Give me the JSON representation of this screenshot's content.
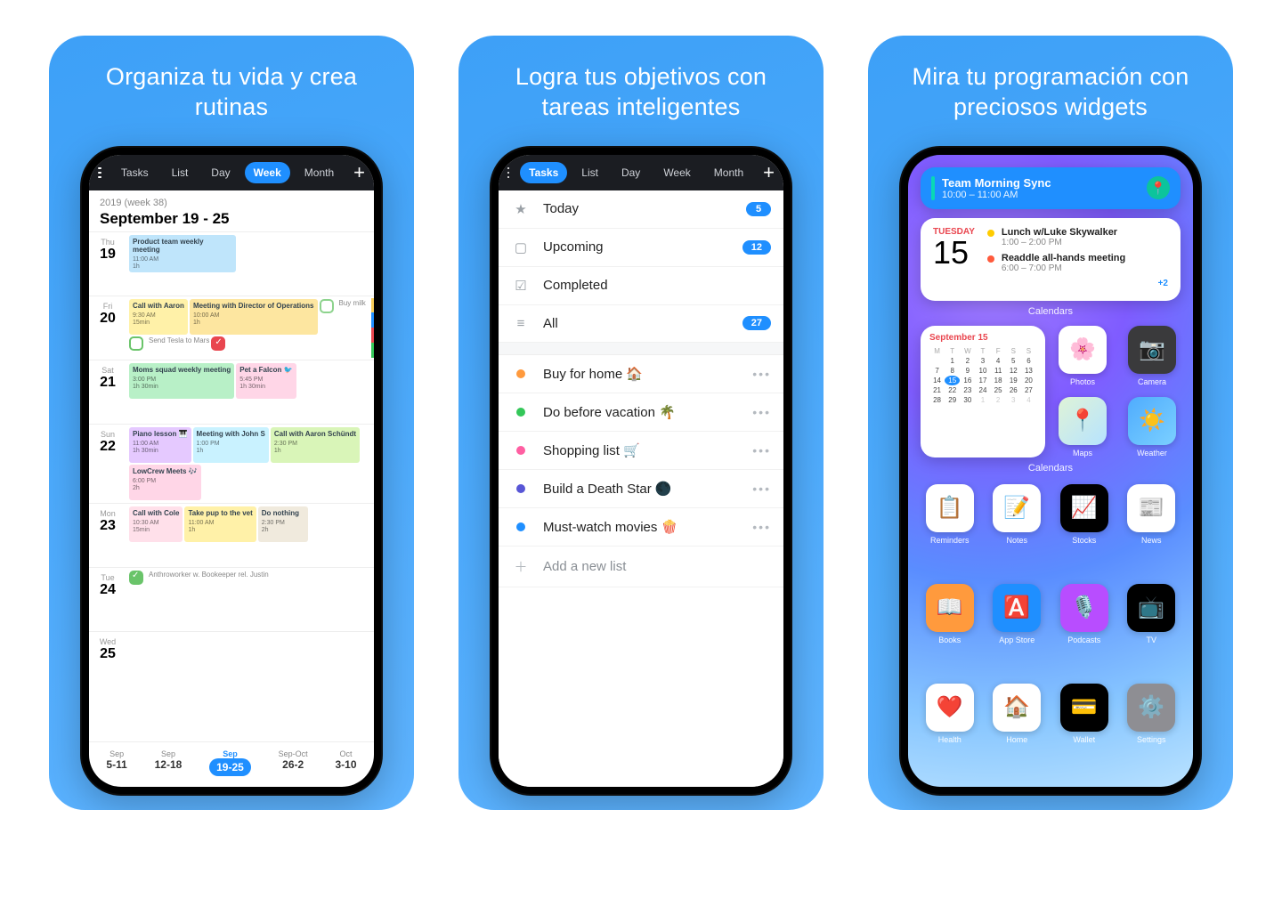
{
  "cards": {
    "c1_headline": "Organiza tu vida y crea rutinas",
    "c2_headline": "Logra tus objetivos con tareas inteligentes",
    "c3_headline": "Mira tu programación con preciosos widgets"
  },
  "nav": {
    "tabs": [
      "Tasks",
      "List",
      "Day",
      "Week",
      "Month"
    ],
    "c1_active": "Week",
    "c2_active": "Tasks"
  },
  "week_view": {
    "subtitle": "2019 (week 38)",
    "title": "September 19 - 25",
    "days": [
      {
        "dow": "Thu",
        "num": "19",
        "events": [
          {
            "title": "Product team weekly meeting",
            "time": "11:00 AM",
            "dur": "1h",
            "color": "#bfe5fb",
            "wide": true
          }
        ]
      },
      {
        "dow": "Fri",
        "num": "20",
        "events": [
          {
            "title": "Call with Aaron",
            "time": "9:30 AM",
            "dur": "15min",
            "color": "#fff1a8"
          },
          {
            "title": "Meeting with Director of Operations",
            "time": "10:00 AM",
            "dur": "1h",
            "color": "#fde6a0"
          }
        ],
        "tasks": [
          {
            "label": "Buy milk",
            "chk": "empty"
          },
          {
            "label": "Send Tesla to Mars",
            "chk": "green"
          },
          {
            "label": "",
            "chk": "red"
          }
        ],
        "stripe": [
          "#f7cc57",
          "#1f8fff",
          "#e9464f",
          "#34c759"
        ]
      },
      {
        "dow": "Sat",
        "num": "21",
        "events": [
          {
            "title": "Moms squad weekly meeting",
            "time": "3:00 PM",
            "dur": "1h 30min",
            "color": "#b8f0c7"
          },
          {
            "title": "Pet a Falcon 🐦",
            "time": "5:45 PM",
            "dur": "1h 30min",
            "color": "#ffd6e7"
          }
        ]
      },
      {
        "dow": "Sun",
        "num": "22",
        "events": [
          {
            "title": "Piano lesson 🎹",
            "time": "11:00 AM",
            "dur": "1h 30min",
            "color": "#e5c9ff"
          },
          {
            "title": "Meeting with John S",
            "time": "1:00 PM",
            "dur": "1h",
            "color": "#c9f2ff"
          },
          {
            "title": "Call with Aaron Schündt",
            "time": "2:30 PM",
            "dur": "1h",
            "color": "#d9f5b8"
          },
          {
            "title": "LowCrew Meets 🎶",
            "time": "6:00 PM",
            "dur": "2h",
            "color": "#ffd6e7"
          }
        ]
      },
      {
        "dow": "Mon",
        "num": "23",
        "events": [
          {
            "title": "Call with Cole",
            "time": "10:30 AM",
            "dur": "15min",
            "color": "#ffe0ea"
          },
          {
            "title": "Take pup to the vet",
            "time": "11:00 AM",
            "dur": "1h",
            "color": "#fff1a8"
          },
          {
            "title": "Do nothing",
            "time": "2:30 PM",
            "dur": "2h",
            "color": "#f0eadd"
          }
        ]
      },
      {
        "dow": "Tue",
        "num": "24",
        "events": [],
        "tasks": [
          {
            "label": "",
            "chk": "greenfilled",
            "note": "Anthroworker w. Bookeeper rel. Justin"
          }
        ]
      },
      {
        "dow": "Wed",
        "num": "25",
        "events": []
      }
    ],
    "strip": [
      {
        "m": "Sep",
        "r": "5-11"
      },
      {
        "m": "Sep",
        "r": "12-18"
      },
      {
        "m": "Sep",
        "r": "19-25",
        "active": true
      },
      {
        "m": "Sep-Oct",
        "r": "26-2"
      },
      {
        "m": "Oct",
        "r": "3-10"
      }
    ]
  },
  "tasks_view": {
    "groups": [
      {
        "icon": "star",
        "label": "Today",
        "count": "5"
      },
      {
        "icon": "calendar",
        "label": "Upcoming",
        "count": "12"
      },
      {
        "icon": "check",
        "label": "Completed",
        "count": ""
      },
      {
        "icon": "list",
        "label": "All",
        "count": "27"
      }
    ],
    "lists": [
      {
        "color": "#ff9a3d",
        "label": "Buy for home 🏠"
      },
      {
        "color": "#34c759",
        "label": "Do before vacation 🌴"
      },
      {
        "color": "#ff5fa2",
        "label": "Shopping list 🛒"
      },
      {
        "color": "#5856d6",
        "label": "Build a Death Star 🌑"
      },
      {
        "color": "#1f8fff",
        "label": "Must-watch movies 🍿"
      }
    ],
    "add": "Add a new list"
  },
  "widgets": {
    "w1": {
      "title": "Team Morning Sync",
      "time": "10:00 – 11:00 AM"
    },
    "w2": {
      "dow": "TUESDAY",
      "day": "15",
      "events": [
        {
          "color": "#ffcc00",
          "title": "Lunch w/Luke Skywalker",
          "time": "1:00 – 2:00 PM"
        },
        {
          "color": "#ff5a3c",
          "title": "Readdle all-hands meeting",
          "time": "6:00 – 7:00 PM"
        }
      ],
      "more": "+2"
    },
    "section": "Calendars",
    "minical": {
      "month": "September",
      "day": "15",
      "dows": [
        "M",
        "T",
        "W",
        "T",
        "F",
        "S",
        "S"
      ],
      "weeks": [
        [
          "",
          "1",
          "2",
          "3",
          "4",
          "5",
          "6"
        ],
        [
          "7",
          "8",
          "9",
          "10",
          "11",
          "12",
          "13"
        ],
        [
          "14",
          "15",
          "16",
          "17",
          "18",
          "19",
          "20"
        ],
        [
          "21",
          "22",
          "23",
          "24",
          "25",
          "26",
          "27"
        ],
        [
          "28",
          "29",
          "30",
          "1",
          "2",
          "3",
          "4"
        ]
      ]
    },
    "apps_right": [
      {
        "name": "Photos",
        "bg": "linear-gradient(135deg,#fff,#fff)",
        "icon": "🌸"
      },
      {
        "name": "Camera",
        "bg": "#3a3a3c",
        "icon": "📷"
      },
      {
        "name": "Maps",
        "bg": "linear-gradient(135deg,#dff3d7,#b6e3ff)",
        "icon": "📍"
      },
      {
        "name": "Weather",
        "bg": "linear-gradient(135deg,#4facfe,#7bd0ff)",
        "icon": "☀️"
      }
    ],
    "apps_grid": [
      {
        "name": "Reminders",
        "bg": "#fff",
        "icon": "📋"
      },
      {
        "name": "Notes",
        "bg": "#fff",
        "icon": "📝"
      },
      {
        "name": "Stocks",
        "bg": "#000",
        "icon": "📈"
      },
      {
        "name": "News",
        "bg": "#fff",
        "icon": "📰"
      },
      {
        "name": "Books",
        "bg": "#ff9a3d",
        "icon": "📖"
      },
      {
        "name": "App Store",
        "bg": "#1f8fff",
        "icon": "🅰️"
      },
      {
        "name": "Podcasts",
        "bg": "#b84dff",
        "icon": "🎙️"
      },
      {
        "name": "TV",
        "bg": "#000",
        "icon": "📺"
      },
      {
        "name": "Health",
        "bg": "#fff",
        "icon": "❤️"
      },
      {
        "name": "Home",
        "bg": "#fff",
        "icon": "🏠"
      },
      {
        "name": "Wallet",
        "bg": "#000",
        "icon": "💳"
      },
      {
        "name": "Settings",
        "bg": "#8e8e93",
        "icon": "⚙️"
      }
    ]
  }
}
